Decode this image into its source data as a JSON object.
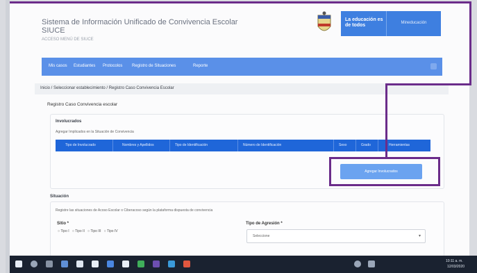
{
  "header": {
    "title_line1": "Sistema de Información Unificado de Convivencia Escolar",
    "title_line2": "SIUCE",
    "subtitle": "ACCESO MENÚ DE SIUCE",
    "edu_brand": "La educación es de todos",
    "edu_ministry": "Mineducación"
  },
  "nav": {
    "items": [
      "Mis casos",
      "Estudiantes",
      "Protocolos",
      "Registro de Situaciones",
      "Reporte"
    ]
  },
  "breadcrumb": "Inicio / Seleccionar establecimiento / Registro Caso Convivencia Escolar",
  "form": {
    "section_title": "Registro Caso Convivencia escolar",
    "involved_title": "Involucrados",
    "involved_hint": "Agregar Implicados en la Situación de Convivencia",
    "columns": [
      "Tipo de Involucrado",
      "Nombres y Apellidos",
      "Tipo de Identificación",
      "Número de Identificación",
      "Sexo",
      "Grado",
      "Herramientas"
    ],
    "add_button": "Agregar Involucrados",
    "situation_title": "Situación",
    "situation_hint": "Registre las situaciones de Acoso Escolar o Ciberacoso según la plataforma dispuesta de convivencia",
    "type_label": "Sitio *",
    "type_options": [
      "Tipo I",
      "Tipo II",
      "Tipo III",
      "Tipo IV"
    ],
    "agresion_label": "Tipo de Agresión *",
    "agresion_value": "Seleccione"
  },
  "taskbar": {
    "time": "10:11 a. m.",
    "date": "12/03/2020"
  },
  "colors": {
    "nav": "#5a90e8",
    "table_header": "#1f66d9",
    "highlight": "#6b2c8a"
  }
}
